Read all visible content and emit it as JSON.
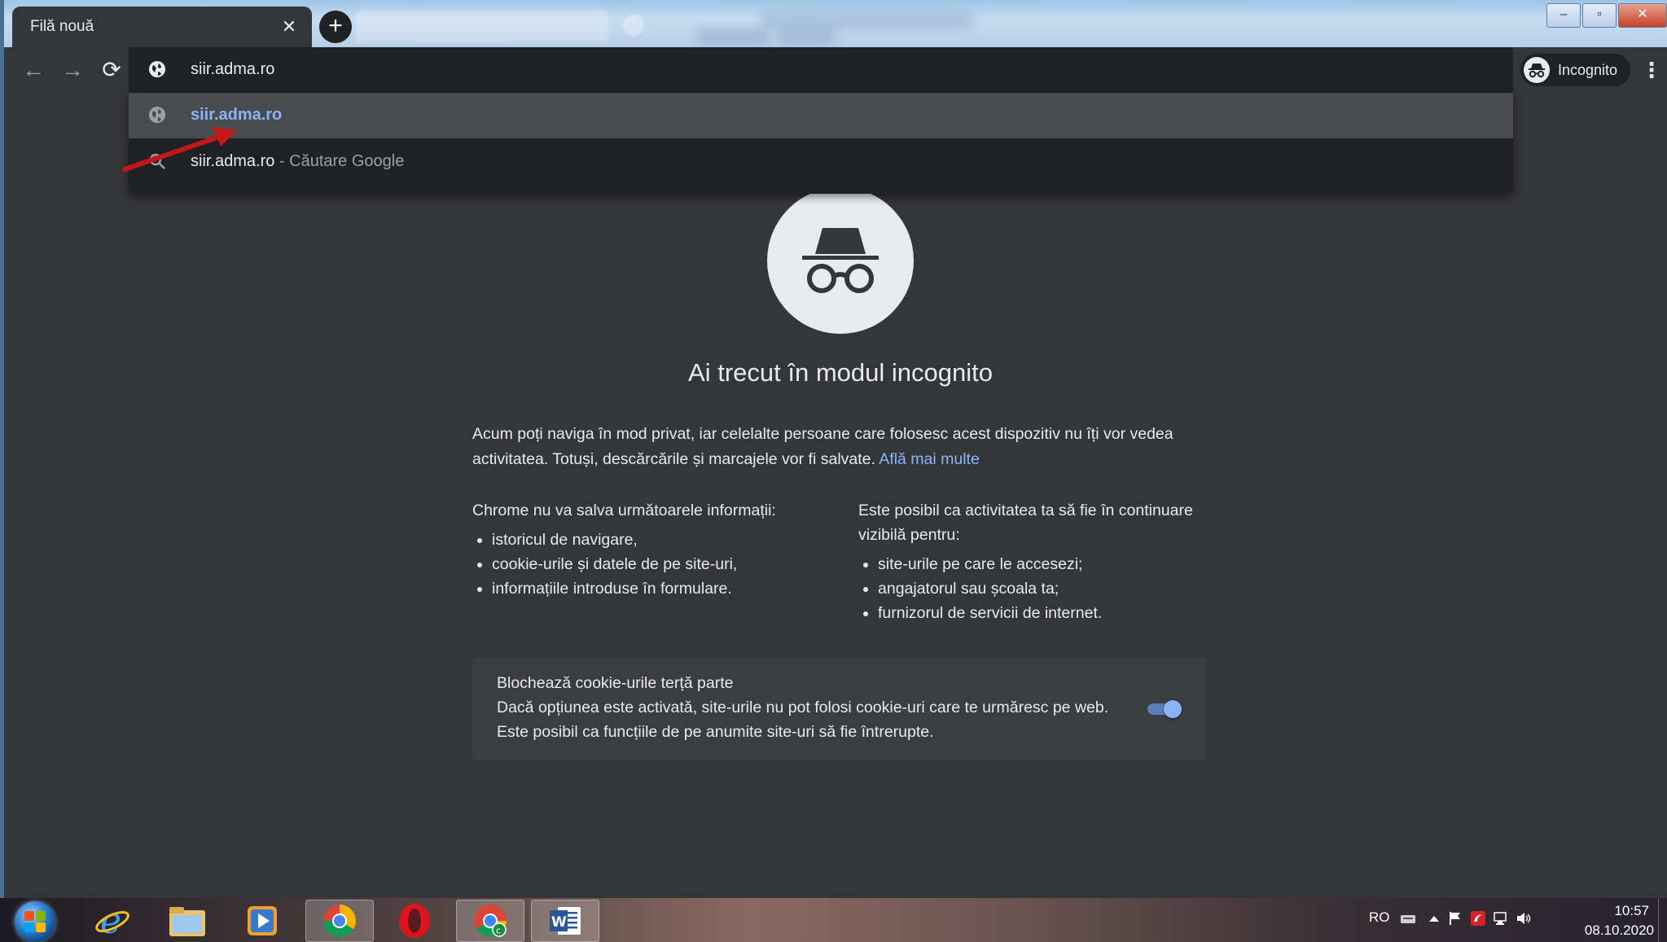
{
  "browser": {
    "active_tab_title": "Filă nouă",
    "tab_close_symbol": "✕",
    "new_tab_symbol": "+",
    "window_controls": {
      "minimize": "–",
      "maximize": "▫",
      "close": "✕"
    },
    "nav": {
      "back": "←",
      "forward": "→",
      "reload": "⟳"
    },
    "omnibox_value": "siir.adma.ro",
    "incognito_label": "Incognito",
    "menu_symbol": "⋮"
  },
  "suggestions": [
    {
      "text": "siir.adma.ro",
      "suffix": "",
      "icon": "globe-icon",
      "selected": true
    },
    {
      "text": "siir.adma.ro",
      "suffix": " - Căutare Google",
      "icon": "search-icon",
      "selected": false
    }
  ],
  "incognito_page": {
    "headline": "Ai trecut în modul incognito",
    "intro": "Acum poți naviga în mod privat, iar celelalte persoane care folosesc acest dispozitiv nu îți vor vedea activitatea. Totuși, descărcările și marcajele vor fi salvate.",
    "learn_more": "Află mai multe",
    "left_column": {
      "heading": "Chrome nu va salva următoarele informații:",
      "items": [
        "istoricul de navigare,",
        "cookie-urile și datele de pe site-uri,",
        "informațiile introduse în formulare."
      ]
    },
    "right_column": {
      "heading": "Este posibil ca activitatea ta să fie în continuare vizibilă pentru:",
      "items": [
        "site-urile pe care le accesezi;",
        "angajatorul sau școala ta;",
        "furnizorul de servicii de internet."
      ]
    },
    "cookie_card": {
      "title": "Blochează cookie-urile terță parte",
      "description": "Dacă opțiunea este activată, site-urile nu pot folosi cookie-uri care te urmăresc pe web. Este posibil ca funcțiile de pe anumite site-uri să fie întrerupte.",
      "toggle_on": true
    }
  },
  "taskbar": {
    "pinned": [
      "internet-explorer-icon",
      "file-explorer-icon",
      "media-player-icon",
      "chrome-icon",
      "opera-icon",
      "chrome-canary-icon",
      "word-icon"
    ],
    "tray": {
      "language": "RO",
      "time": "10:57",
      "date": "08.10.2020"
    }
  },
  "colors": {
    "page_bg": "#35363a",
    "omnibox_bg": "#202124",
    "link": "#8ab4f8",
    "annotation_arrow": "#c41818"
  }
}
